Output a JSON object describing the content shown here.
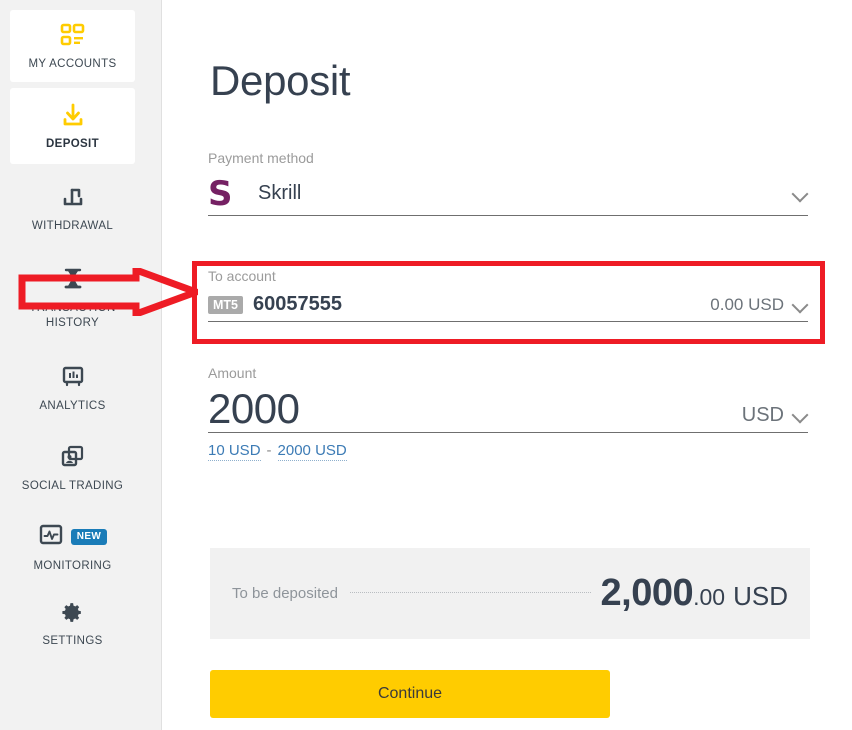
{
  "sidebar": {
    "items": [
      {
        "label": "MY ACCOUNTS",
        "icon": "dashboard-grid-icon",
        "active": false,
        "card": true
      },
      {
        "label": "DEPOSIT",
        "icon": "download-icon",
        "active": true,
        "card": true
      },
      {
        "label": "WITHDRAWAL",
        "icon": "upload-share-icon",
        "active": false,
        "card": false
      },
      {
        "label": "TRANSACTION HISTORY",
        "icon": "hourglass-icon",
        "active": false,
        "card": false
      },
      {
        "label": "ANALYTICS",
        "icon": "chart-board-icon",
        "active": false,
        "card": false
      },
      {
        "label": "SOCIAL TRADING",
        "icon": "social-cards-icon",
        "active": false,
        "card": false
      },
      {
        "label": "MONITORING",
        "icon": "monitor-pulse-icon",
        "active": false,
        "card": false,
        "badge": "NEW"
      },
      {
        "label": "SETTINGS",
        "icon": "gear-icon",
        "active": false,
        "card": false
      }
    ]
  },
  "main": {
    "title": "Deposit",
    "payment_method": {
      "label": "Payment method",
      "value": "Skrill",
      "logo_letter": "S",
      "logo_color": "#752063"
    },
    "to_account": {
      "label": "To account",
      "platform_badge": "MT5",
      "account_number": "60057555",
      "balance": "0.00 USD"
    },
    "amount": {
      "label": "Amount",
      "value": "2000",
      "currency": "USD",
      "min_label": "10 USD",
      "separator": "-",
      "max_label": "2000 USD"
    },
    "summary": {
      "label": "To be deposited",
      "integer": "2,000",
      "decimal": ".00",
      "currency": "USD"
    },
    "continue_label": "Continue"
  },
  "annotations": {
    "highlight_color": "#ee1c25",
    "arrow_target": "to-account-field",
    "box_target": "to-account-field"
  },
  "colors": {
    "accent_yellow": "#ffcc00",
    "badge_blue": "#1a7cb8",
    "text_dark": "#364150",
    "sidebar_bg": "#f2f2f2"
  }
}
